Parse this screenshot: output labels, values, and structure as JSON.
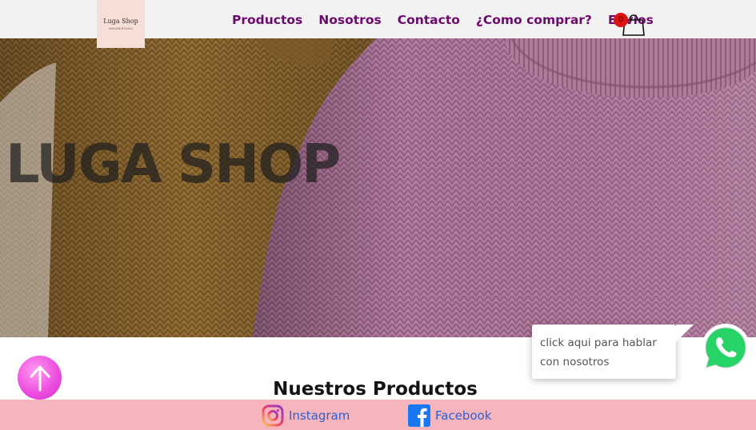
{
  "brand": {
    "logo_title": "Luga Shop",
    "logo_subtitle": "INDUMENTARIA"
  },
  "nav": {
    "items": [
      {
        "label": "Productos"
      },
      {
        "label": "Nosotros"
      },
      {
        "label": "Contacto"
      },
      {
        "label": "¿Como comprar?"
      },
      {
        "label": "Envios"
      }
    ]
  },
  "cart": {
    "count": "0",
    "icon": "shopping-bag-icon"
  },
  "hero": {
    "title": "LUGA SHOP"
  },
  "main": {
    "section_title": "Nuestros Productos"
  },
  "chat": {
    "bubble_line1": "click aqui para hablar",
    "bubble_line2": "con nosotros",
    "icon": "whatsapp-icon"
  },
  "scroll_top": {
    "icon": "arrow-up-icon"
  },
  "footer": {
    "instagram_label": "Instagram",
    "facebook_label": "Facebook"
  },
  "colors": {
    "nav_text": "#6d0a6d",
    "footer_bg": "#f6b5bd",
    "social_link": "#2d5fd0",
    "whatsapp": "#25d366",
    "cart_badge": "#e01313"
  }
}
